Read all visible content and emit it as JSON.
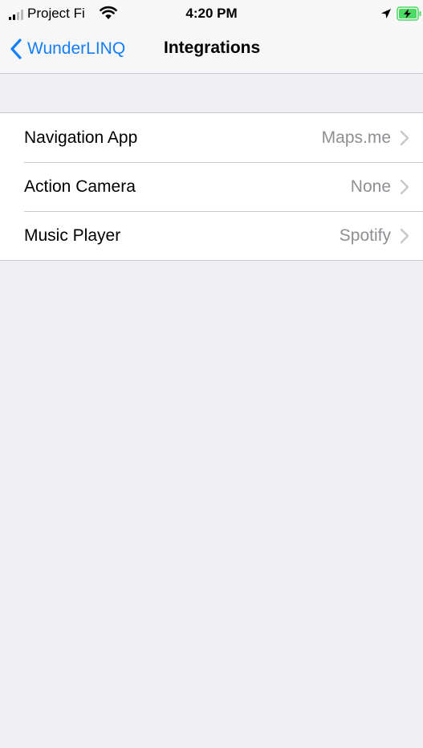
{
  "status_bar": {
    "carrier": "Project Fi",
    "time": "4:20 PM",
    "signal_icon": "signal-bars-icon",
    "wifi_icon": "wifi-icon",
    "location_icon": "location-arrow-icon",
    "battery_icon": "battery-charging-icon",
    "battery_color": "#4cd964"
  },
  "nav": {
    "back_label": "WunderLINQ",
    "back_icon": "chevron-left-icon",
    "title": "Integrations",
    "accent_color": "#147efb"
  },
  "integrations": {
    "rows": [
      {
        "title": "Navigation App",
        "value": "Maps.me"
      },
      {
        "title": "Action Camera",
        "value": "None"
      },
      {
        "title": "Music Player",
        "value": "Spotify"
      }
    ],
    "disclosure_icon": "chevron-right-icon"
  }
}
